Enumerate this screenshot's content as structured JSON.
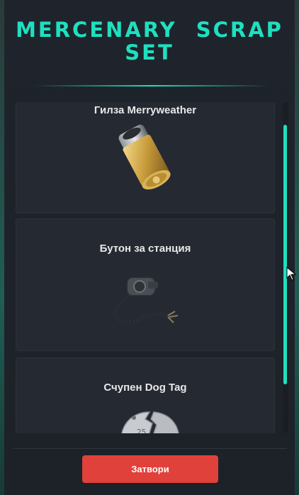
{
  "dialog": {
    "title": "MERCENARY SCRAP SET",
    "close_label": "Затвори"
  },
  "items": [
    {
      "label": "Гилза Merryweather",
      "icon": "bullet-casing-icon"
    },
    {
      "label": "Бутон за станция",
      "icon": "radio-microphone-icon"
    },
    {
      "label": "Счупен Dog Tag",
      "icon": "broken-dog-tag-icon"
    }
  ],
  "colors": {
    "accent": "#1ee0c0",
    "button": "#e0413a",
    "card": "#252932",
    "background": "#1d2128"
  }
}
